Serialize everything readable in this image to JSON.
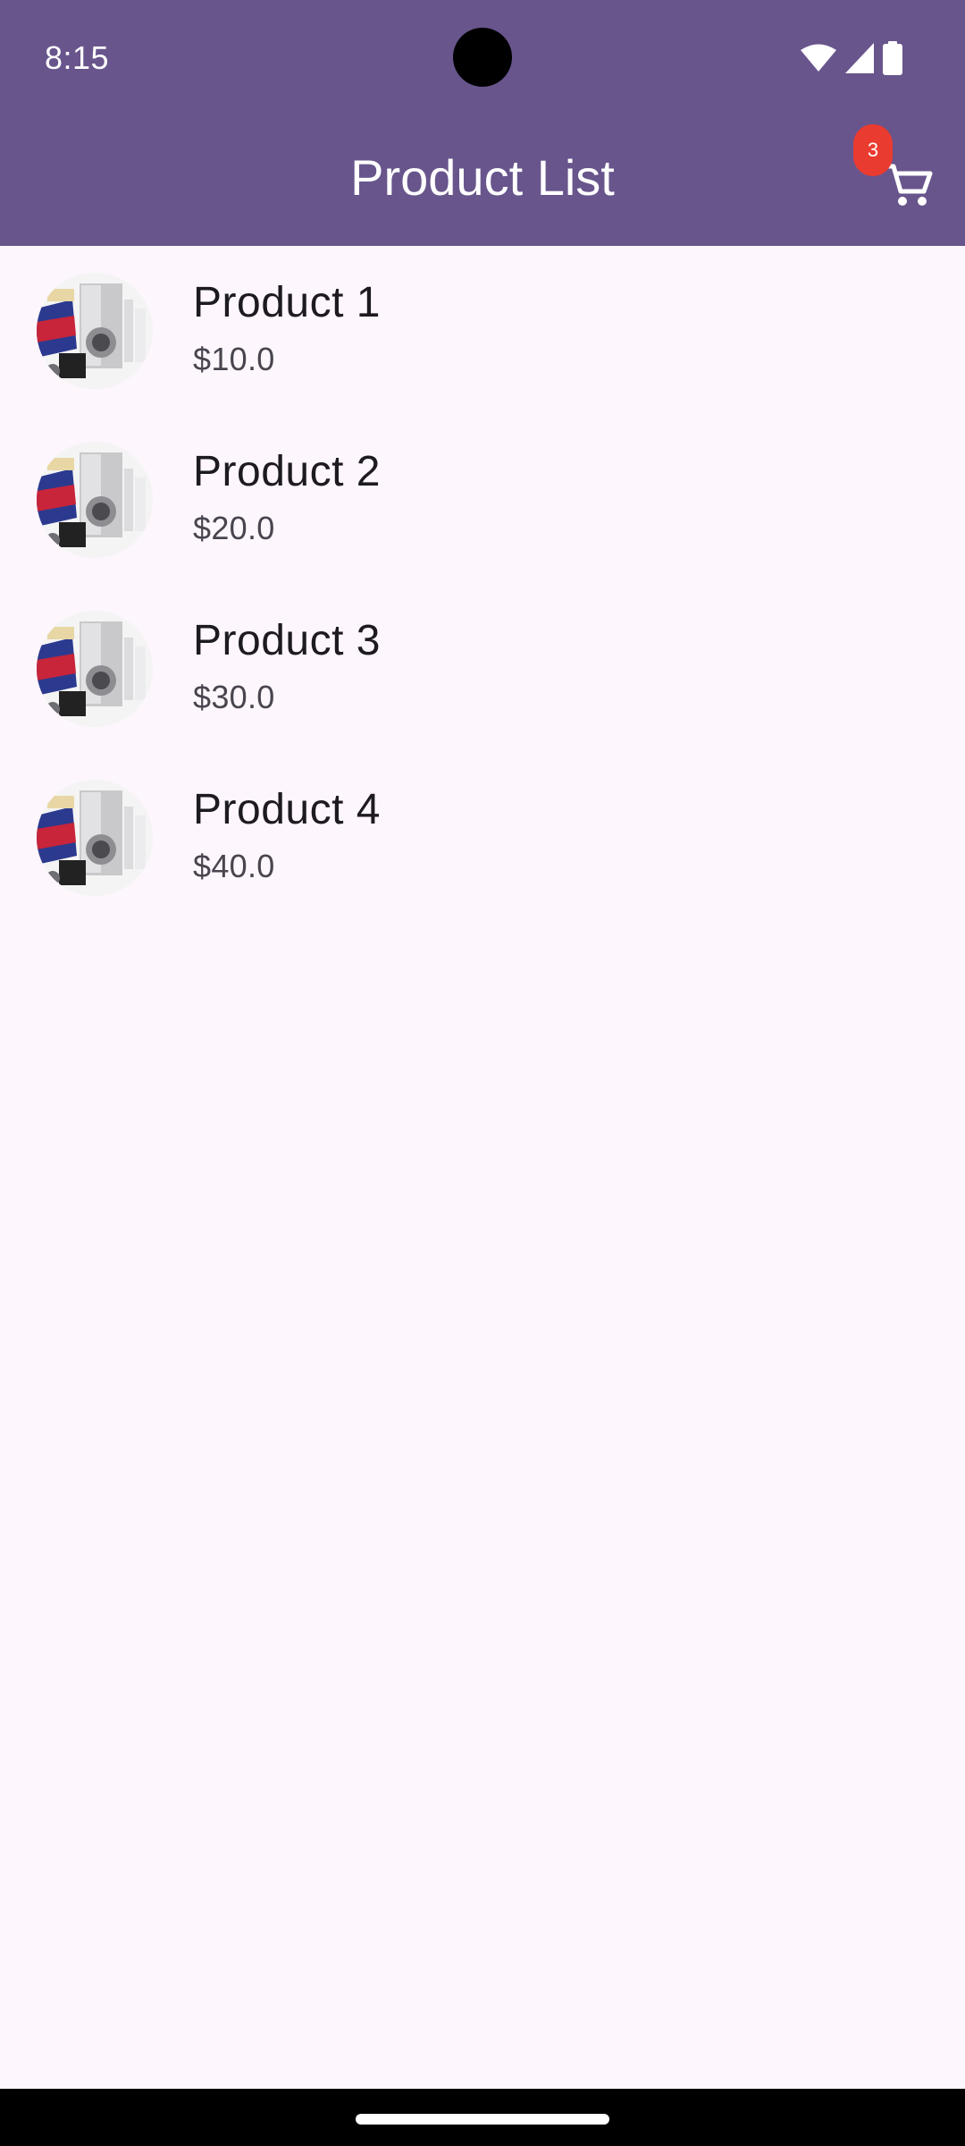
{
  "status_bar": {
    "time": "8:15",
    "icons": [
      "wifi-icon",
      "cellular-signal-icon",
      "battery-icon"
    ]
  },
  "app_bar": {
    "title": "Product List",
    "cart_icon": "shopping-cart-icon",
    "cart_badge_count": "3",
    "background_color": "#68558c",
    "badge_color": "#ea3b30"
  },
  "products": [
    {
      "name": "Product 1",
      "price": "$10.0",
      "image": "appliances-thumbnail"
    },
    {
      "name": "Product 2",
      "price": "$20.0",
      "image": "appliances-thumbnail"
    },
    {
      "name": "Product 3",
      "price": "$30.0",
      "image": "appliances-thumbnail"
    },
    {
      "name": "Product 4",
      "price": "$40.0",
      "image": "appliances-thumbnail"
    }
  ],
  "colors": {
    "background": "#fdf6fd",
    "title_text": "#1d1b20",
    "subtitle_text": "#49454f"
  }
}
